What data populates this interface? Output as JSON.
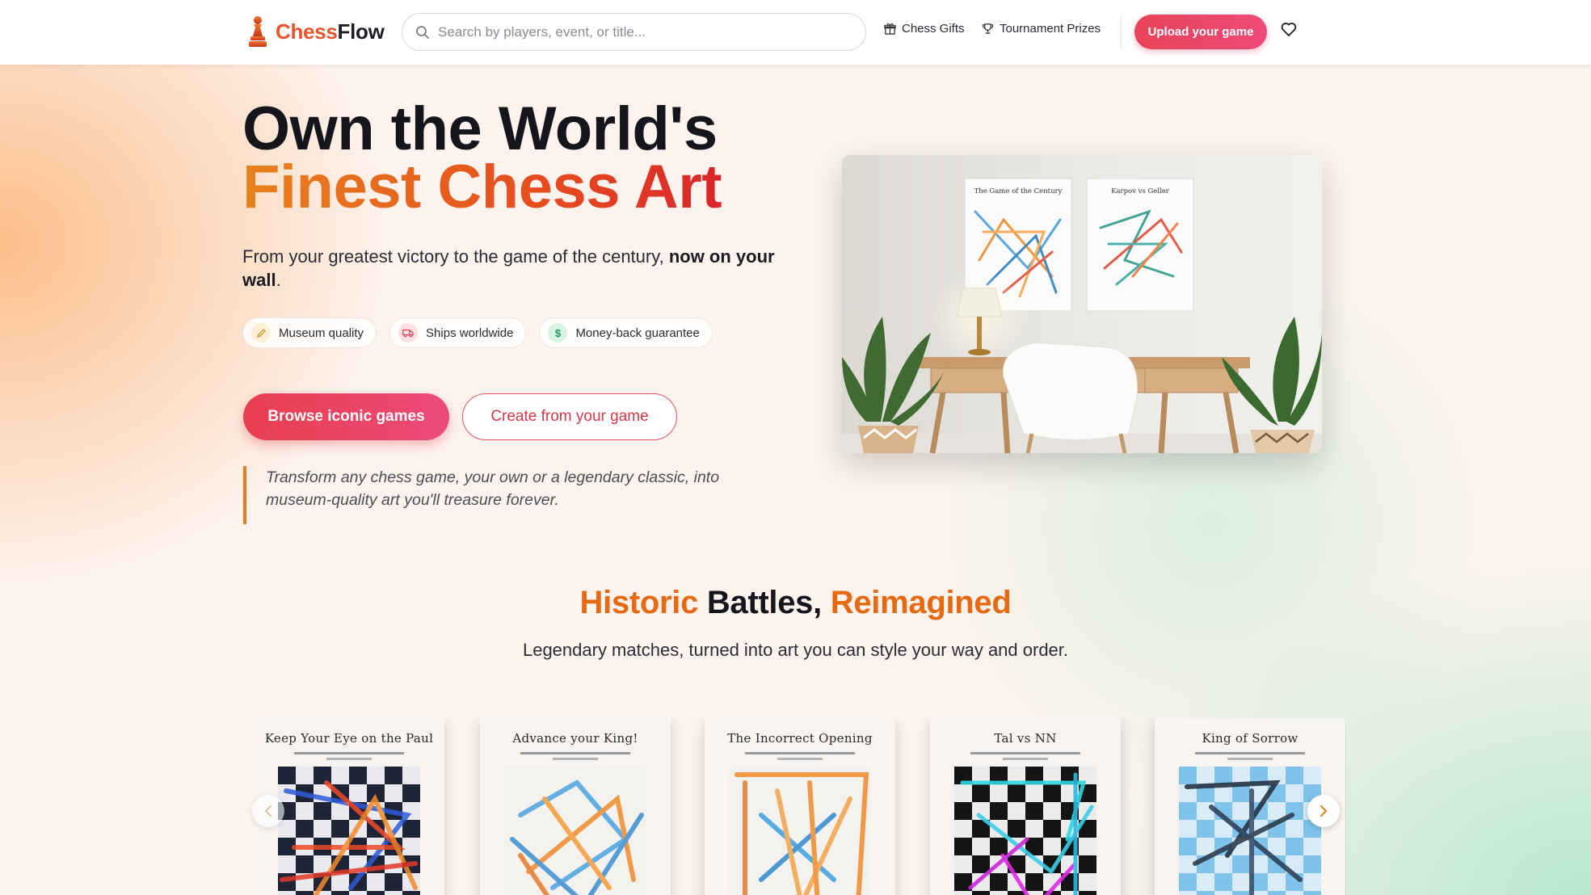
{
  "brand": {
    "part1": "Chess",
    "part2": "Flow",
    "accent": "#e8532c"
  },
  "search": {
    "placeholder": "Search by players, event, or title..."
  },
  "nav": {
    "gifts": "Chess Gifts",
    "prizes": "Tournament Prizes",
    "upload": "Upload your game"
  },
  "hero": {
    "title_line1": "Own the World's",
    "title_line2": "Finest Chess Art",
    "subtitle_start": "From your greatest victory to the game of the century, ",
    "subtitle_bold": "now on your wall",
    "subtitle_end": ".",
    "chips": [
      "Museum quality",
      "Ships worldwide",
      "Money-back guarantee"
    ],
    "cta_primary": "Browse iconic games",
    "cta_secondary": "Create from your game",
    "quote": "Transform any chess game, your own or a legendary classic, into museum-quality art you'll treasure forever."
  },
  "room_image": {
    "poster_1": "The Game of the Century",
    "poster_2": "Karpov vs Geller"
  },
  "section": {
    "title_w1": "Historic",
    "title_w2": "Battles,",
    "title_w3": "Reimagined",
    "subtitle": "Legendary matches, turned into art you can style your way and order."
  },
  "cards": [
    {
      "title": "Keep Your Eye on the Paul"
    },
    {
      "title": "Advance your King!"
    },
    {
      "title": "The Incorrect Opening"
    },
    {
      "title": "Tal vs NN"
    },
    {
      "title": "King of Sorrow"
    }
  ],
  "colors": {
    "primary": "#e83e4f",
    "orange": "#e56a12"
  }
}
